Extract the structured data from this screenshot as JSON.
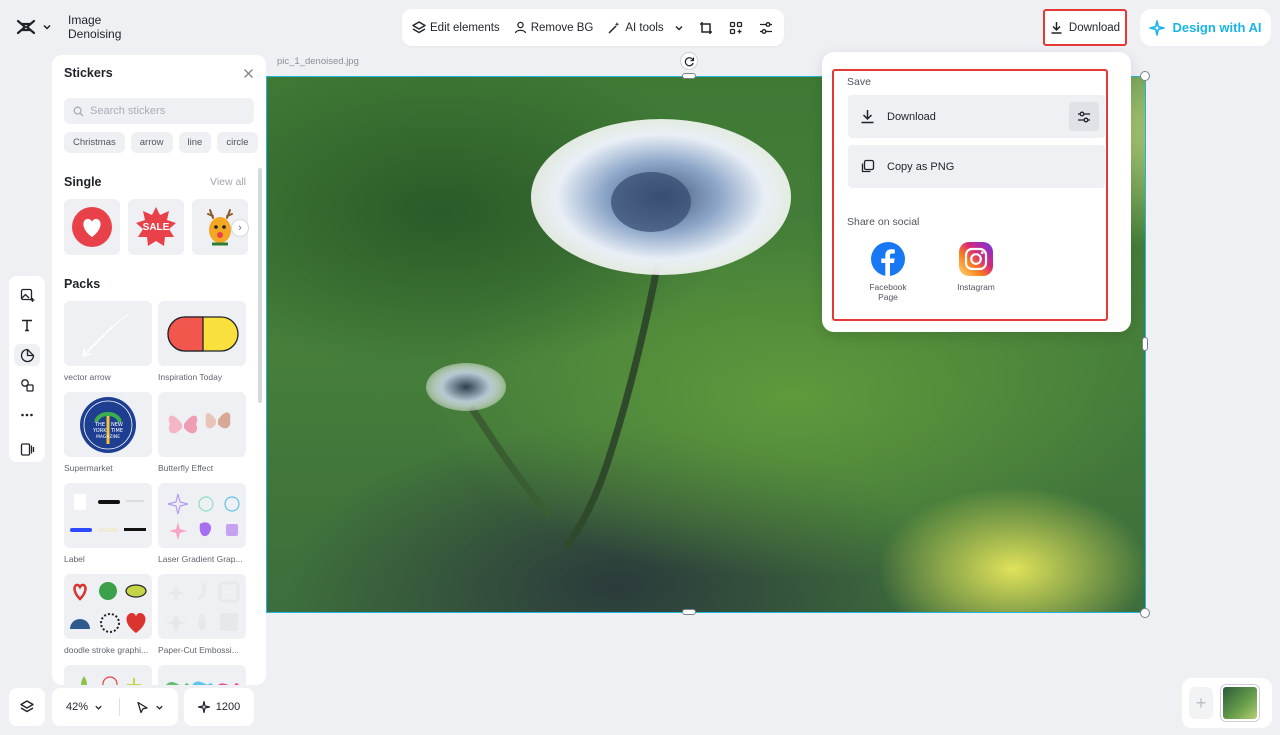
{
  "app": {
    "title": "Image Denoising"
  },
  "toolbar": {
    "edit_elements": "Edit elements",
    "remove_bg": "Remove BG",
    "ai_tools": "AI tools"
  },
  "top_right": {
    "download": "Download",
    "design_ai": "Design with AI"
  },
  "stickers": {
    "title": "Stickers",
    "search_placeholder": "Search stickers",
    "chips": [
      "Christmas",
      "arrow",
      "line",
      "circle"
    ],
    "single_title": "Single",
    "view_all": "View all",
    "single_items": [
      "heart-sticker",
      "SALE",
      "reindeer-sticker"
    ],
    "packs_title": "Packs",
    "packs": [
      {
        "label": "vector arrow"
      },
      {
        "label": "Inspiration Today"
      },
      {
        "label": "Supermarket"
      },
      {
        "label": "Butterfly Effect"
      },
      {
        "label": "Label"
      },
      {
        "label": "Laser Gradient Grap..."
      },
      {
        "label": "doodle stroke graphi..."
      },
      {
        "label": "Paper-Cut Embossi..."
      }
    ],
    "badge_text": [
      "THE",
      "NEW",
      "YORK",
      "TIME",
      "MAGAZINE"
    ]
  },
  "canvas": {
    "file_name": "pic_1_denoised.jpg"
  },
  "download_menu": {
    "save_label": "Save",
    "download": "Download",
    "copy_png": "Copy as PNG",
    "share_label": "Share on social",
    "facebook_line1": "Facebook",
    "facebook_line2": "Page",
    "instagram": "Instagram"
  },
  "bottom": {
    "zoom": "42%",
    "credits": "1200"
  },
  "colors": {
    "accent": "#19b4e8",
    "highlight": "#e53935",
    "selection": "#22b5dd"
  }
}
